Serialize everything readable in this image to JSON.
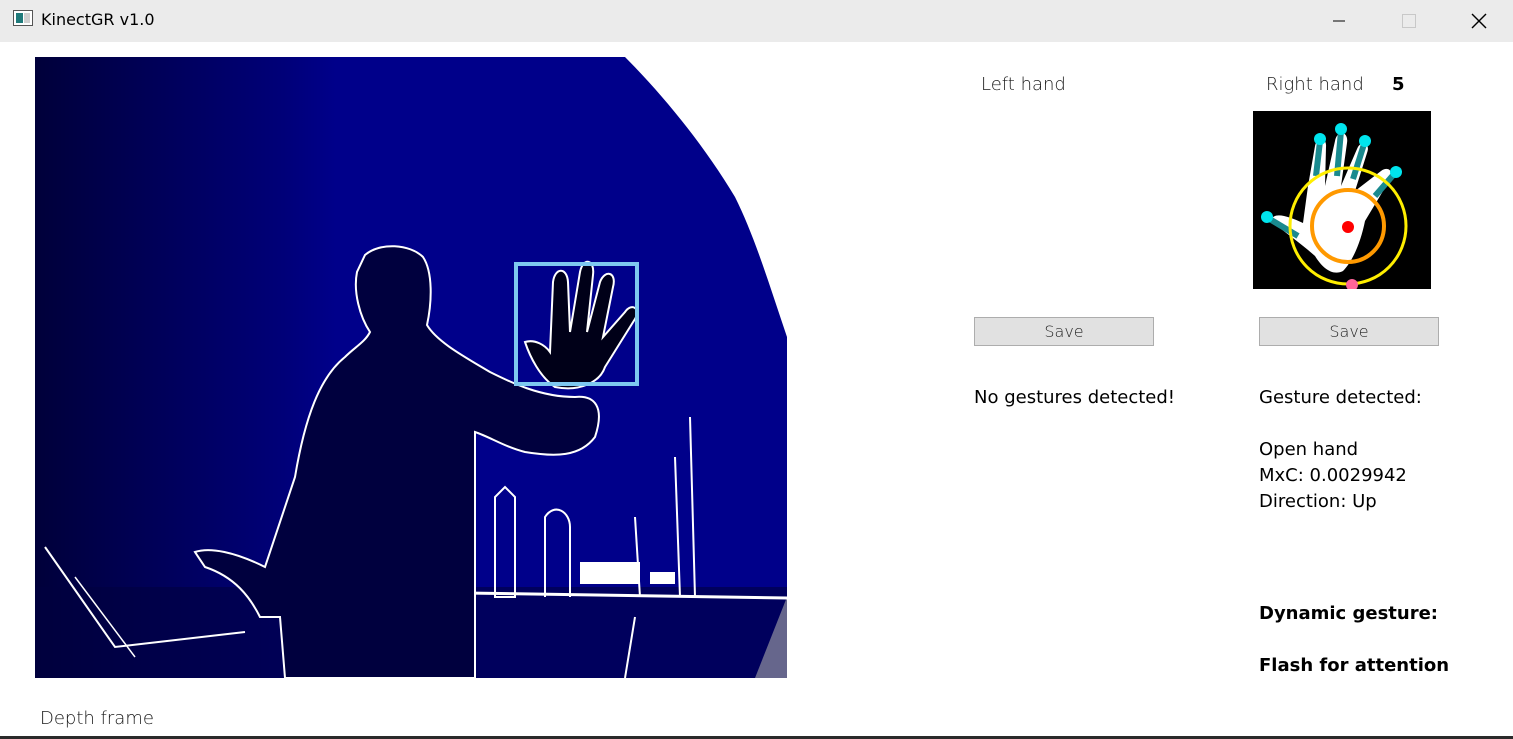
{
  "window": {
    "title": "KinectGR v1.0",
    "icon": "app-window-icon",
    "controls": [
      "minimize-icon",
      "maximize-icon",
      "close-icon"
    ]
  },
  "depth_view": {
    "label": "Depth frame",
    "background_color": "#00007a",
    "tracking_box_color": "#7ec8f0"
  },
  "left_hand": {
    "label": "Left hand",
    "save_label": "Save",
    "status": "No gestures detected!"
  },
  "right_hand": {
    "label": "Right hand",
    "finger_count": "5",
    "save_label": "Save",
    "status_heading": "Gesture detected:",
    "gesture_name": "Open hand",
    "mxc": "MxC: 0.0029942",
    "direction": "Direction: Up",
    "dynamic_heading": "Dynamic gesture:",
    "dynamic_value": "Flash for attention"
  },
  "colors": {
    "fingertip": "#00e5ee",
    "finger_line": "#1a8a8f",
    "palm_center": "#ff0000",
    "inner_circle": "#ff9900",
    "outer_circle": "#ffee00",
    "wrist_point": "#ff6699"
  }
}
